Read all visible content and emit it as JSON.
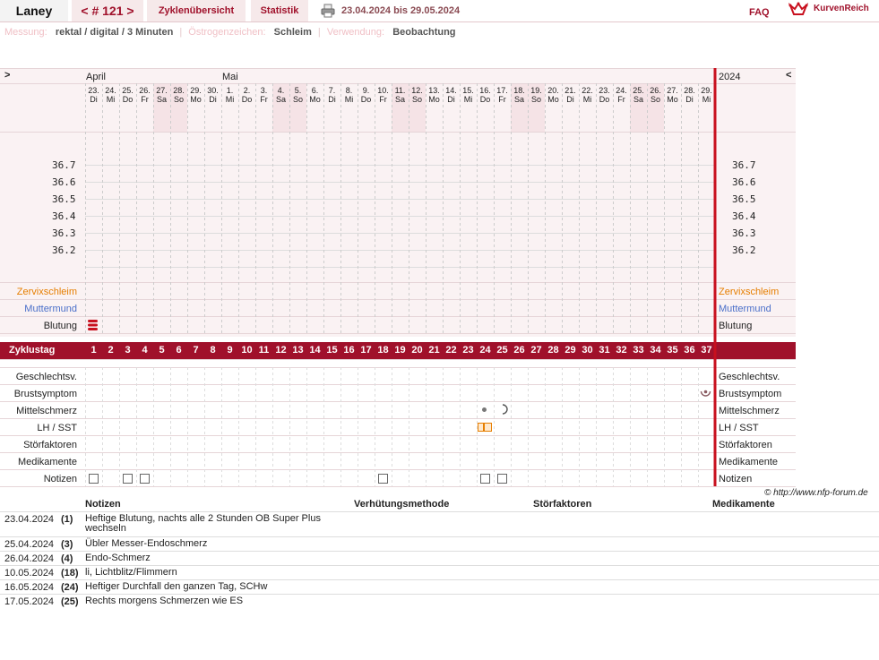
{
  "header": {
    "name": "Laney",
    "cycle": "< # 121 >",
    "tab_overview": "Zyklenübersicht",
    "tab_stats": "Statistik",
    "range": "23.04.2024 bis 29.05.2024",
    "faq": "FAQ",
    "logo": "KurvenReich"
  },
  "meta": {
    "messung_label": "Messung:",
    "messung_value": "rektal / digital / 3 Minuten",
    "oestrogen_label": "Östrogenzeichen:",
    "oestrogen_value": "Schleim",
    "verwendung_label": "Verwendung:",
    "verwendung_value": "Beobachtung"
  },
  "chart": {
    "nav_left": ">",
    "nav_right": "<",
    "year": "2024",
    "month_april": "April",
    "month_mai": "Mai",
    "days": [
      {
        "d": "23.",
        "w": "Di"
      },
      {
        "d": "24.",
        "w": "Mi"
      },
      {
        "d": "25.",
        "w": "Do"
      },
      {
        "d": "26.",
        "w": "Fr"
      },
      {
        "d": "27.",
        "w": "Sa"
      },
      {
        "d": "28.",
        "w": "So"
      },
      {
        "d": "29.",
        "w": "Mo"
      },
      {
        "d": "30.",
        "w": "Di"
      },
      {
        "d": "1.",
        "w": "Mi"
      },
      {
        "d": "2.",
        "w": "Do"
      },
      {
        "d": "3.",
        "w": "Fr"
      },
      {
        "d": "4.",
        "w": "Sa"
      },
      {
        "d": "5.",
        "w": "So"
      },
      {
        "d": "6.",
        "w": "Mo"
      },
      {
        "d": "7.",
        "w": "Di"
      },
      {
        "d": "8.",
        "w": "Mi"
      },
      {
        "d": "9.",
        "w": "Do"
      },
      {
        "d": "10.",
        "w": "Fr"
      },
      {
        "d": "11.",
        "w": "Sa"
      },
      {
        "d": "12.",
        "w": "So"
      },
      {
        "d": "13.",
        "w": "Mo"
      },
      {
        "d": "14.",
        "w": "Di"
      },
      {
        "d": "15.",
        "w": "Mi"
      },
      {
        "d": "16.",
        "w": "Do"
      },
      {
        "d": "17.",
        "w": "Fr"
      },
      {
        "d": "18.",
        "w": "Sa"
      },
      {
        "d": "19.",
        "w": "So"
      },
      {
        "d": "20.",
        "w": "Mo"
      },
      {
        "d": "21.",
        "w": "Di"
      },
      {
        "d": "22.",
        "w": "Mi"
      },
      {
        "d": "23.",
        "w": "Do"
      },
      {
        "d": "24.",
        "w": "Fr"
      },
      {
        "d": "25.",
        "w": "Sa"
      },
      {
        "d": "26.",
        "w": "So"
      },
      {
        "d": "27.",
        "w": "Mo"
      },
      {
        "d": "28.",
        "w": "Di"
      },
      {
        "d": "29.",
        "w": "Mi"
      }
    ],
    "temps": [
      "36.7",
      "36.6",
      "36.5",
      "36.4",
      "36.3",
      "36.2"
    ],
    "rows": {
      "zervix": "Zervixschleim",
      "muttermund": "Muttermund",
      "blutung": "Blutung",
      "zyklustag": "Zyklustag",
      "gv": "Geschlechtsv.",
      "brust": "Brustsymptom",
      "mittel": "Mittelschmerz",
      "lh": "LH / SST",
      "stoer": "Störfaktoren",
      "medi": "Medikamente",
      "notizen": "Notizen"
    },
    "zyklustage": [
      "1",
      "2",
      "3",
      "4",
      "5",
      "6",
      "7",
      "8",
      "9",
      "10",
      "11",
      "12",
      "13",
      "14",
      "15",
      "16",
      "17",
      "18",
      "19",
      "20",
      "21",
      "22",
      "23",
      "24",
      "25",
      "26",
      "27",
      "28",
      "29",
      "30",
      "31",
      "32",
      "33",
      "34",
      "35",
      "36",
      "37"
    ],
    "note_days": [
      1,
      3,
      4,
      18,
      24,
      25
    ],
    "colors": {
      "accent": "#a0112b",
      "weekend": "#f5e3e6",
      "zervix": "#e67e00",
      "muttermund": "#4a6fc9",
      "vline": "#c8101e"
    }
  },
  "copyright": "© http://www.nfp-forum.de",
  "notes_table": {
    "headers": {
      "notizen": "Notizen",
      "verhuetung": "Verhütungsmethode",
      "stoer": "Störfaktoren",
      "medi": "Medikamente"
    },
    "rows": [
      {
        "date": "23.04.2024",
        "num": "(1)",
        "text": "Heftige Blutung, nachts alle 2 Stunden OB Super Plus wechseln"
      },
      {
        "date": "25.04.2024",
        "num": "(3)",
        "text": "Übler Messer-Endoschmerz"
      },
      {
        "date": "26.04.2024",
        "num": "(4)",
        "text": "Endo-Schmerz"
      },
      {
        "date": "10.05.2024",
        "num": "(18)",
        "text": "li, Lichtblitz/Flimmern"
      },
      {
        "date": "16.05.2024",
        "num": "(24)",
        "text": "Heftiger Durchfall den ganzen Tag, SCHw"
      },
      {
        "date": "17.05.2024",
        "num": "(25)",
        "text": "Rechts morgens Schmerzen wie ES"
      }
    ]
  }
}
